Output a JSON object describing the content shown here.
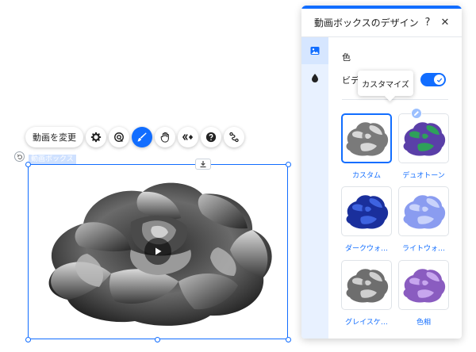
{
  "toolbar": {
    "change_video_label": "動画を変更",
    "buttons": [
      "settings-icon",
      "animation-icon",
      "design-brush-icon",
      "hover-hand-icon",
      "code-icon",
      "help-icon",
      "link-icon"
    ]
  },
  "element": {
    "label": "動画ボックス"
  },
  "panel": {
    "title": "動画ボックスのデザイン",
    "help_label": "?",
    "close_label": "✕",
    "section_title": "色",
    "toggle_label": "ビデ",
    "toggle_on": true,
    "tooltip": "カスタマイズ",
    "presets": [
      {
        "caption": "カスタム",
        "selected": true,
        "tint": "#7a7a7a",
        "accent": "#d8d8d8"
      },
      {
        "caption": "デュオトーン",
        "selected": false,
        "tint": "#5a3fa8",
        "accent": "#2ea05a"
      },
      {
        "caption": "ダークウォ…",
        "selected": false,
        "tint": "#1a2f9c",
        "accent": "#3e63e0"
      },
      {
        "caption": "ライトウォ…",
        "selected": false,
        "tint": "#8a9cf0",
        "accent": "#c9d3fb"
      },
      {
        "caption": "グレイスケ…",
        "selected": false,
        "tint": "#6e6e6e",
        "accent": "#cfcfcf"
      },
      {
        "caption": "色相",
        "selected": false,
        "tint": "#8a5cc0",
        "accent": "#c7a6ee"
      }
    ]
  },
  "colors": {
    "accent": "#116dff",
    "panel_side": "#e8f1ff"
  }
}
